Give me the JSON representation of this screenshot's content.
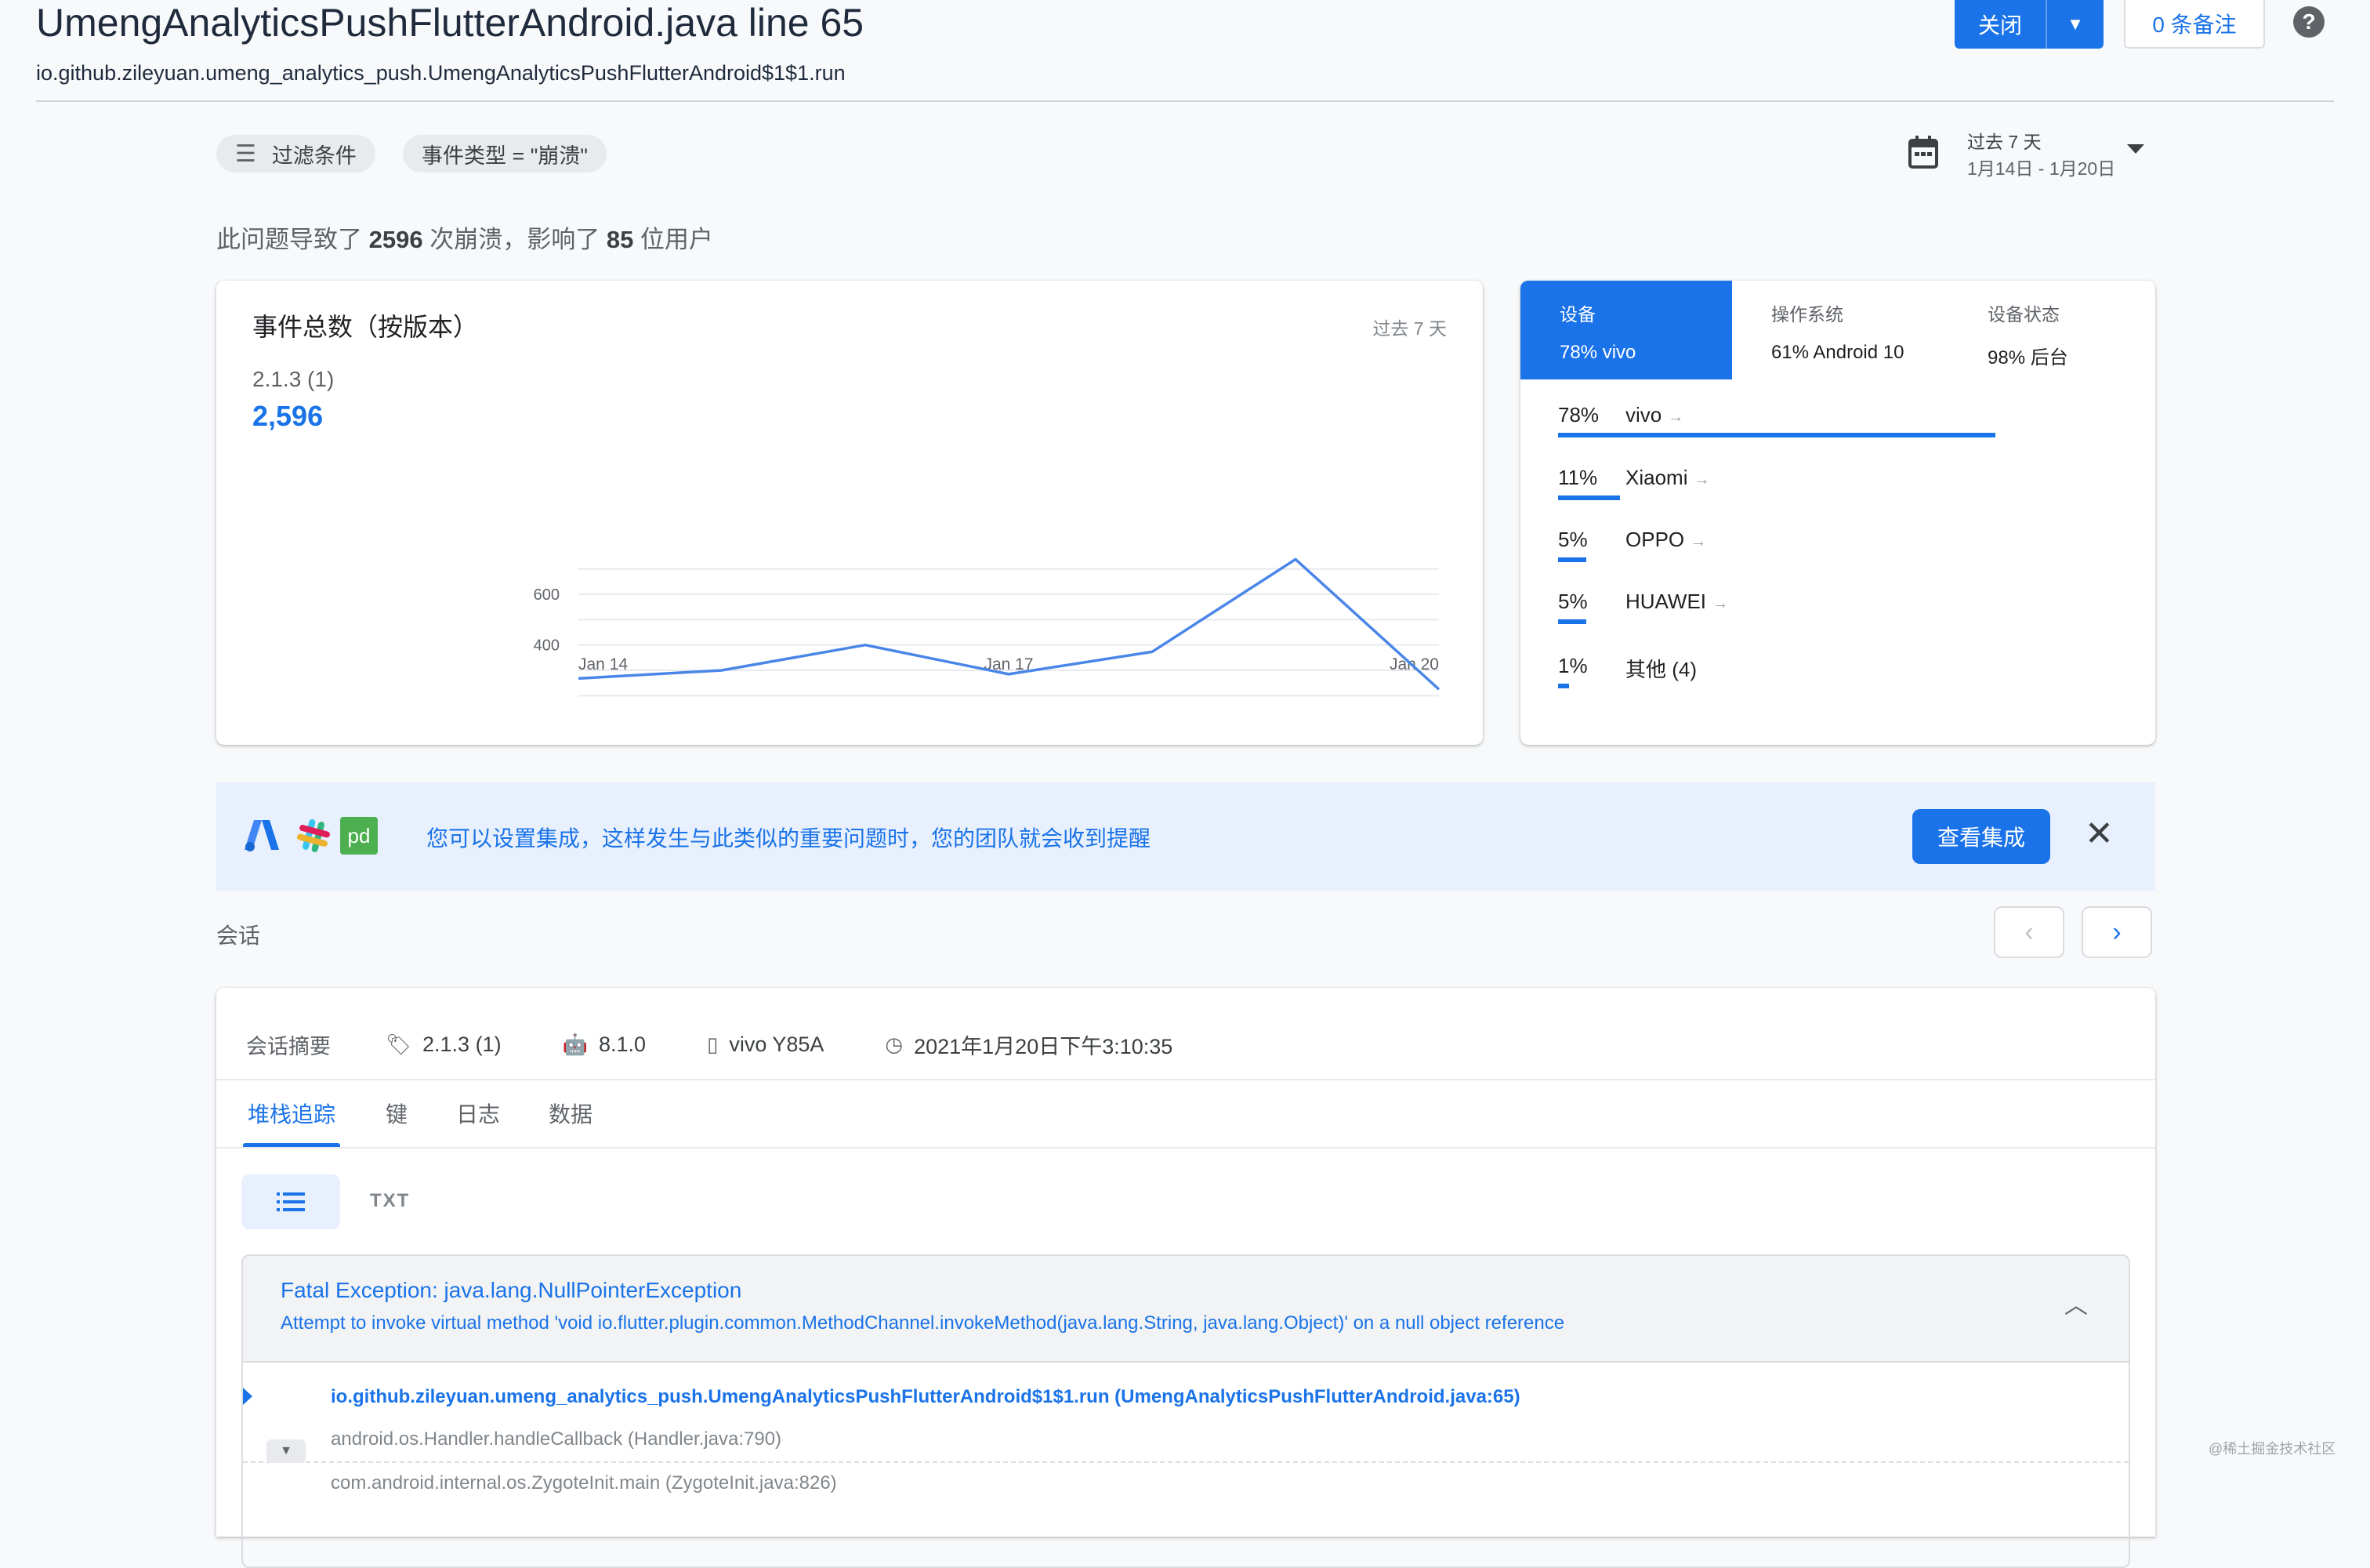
{
  "header": {
    "title": "UmengAnalyticsPushFlutterAndroid.java line 65",
    "subtitle": "io.github.zileyuan.umeng_analytics_push.UmengAnalyticsPushFlutterAndroid$1$1.run",
    "close_label": "关闭",
    "notes_label": "0 条备注",
    "help_label": "?"
  },
  "filters": {
    "filter_label": "过滤条件",
    "event_type": "事件类型 = \"崩溃\"",
    "date_range": "过去 7 天",
    "date_sub": "1月14日 - 1月20日"
  },
  "summary": {
    "prefix": "此问题导致了 ",
    "crashes": "2596",
    "middle": " 次崩溃，影响了 ",
    "users": "85",
    "suffix": " 位用户"
  },
  "events_chart": {
    "title": "事件总数（按版本）",
    "range_label": "过去 7 天",
    "version": "2.1.3 (1)",
    "total": "2,596"
  },
  "chart_data": {
    "type": "line",
    "title": "事件总数（按版本）",
    "x": [
      "Jan 14",
      "Jan 15",
      "Jan 16",
      "Jan 17",
      "Jan 18",
      "Jan 19",
      "Jan 20"
    ],
    "series": [
      {
        "name": "2.1.3 (1)",
        "values": [
          268,
          300,
          400,
          285,
          373,
          738,
          225
        ]
      }
    ],
    "x_tick_labels": [
      "Jan 14",
      "Jan 17",
      "Jan 20"
    ],
    "y_ticks": [
      400,
      600
    ],
    "ylim": [
      200,
      800
    ],
    "grid": true,
    "color": "#4a86e8"
  },
  "device_panel": {
    "tabs": [
      {
        "label": "设备",
        "value": "78% vivo",
        "active": true
      },
      {
        "label": "操作系统",
        "value": "61% Android 10",
        "active": false
      },
      {
        "label": "设备状态",
        "value": "98% 后台",
        "active": false
      }
    ],
    "rows": [
      {
        "pct": "78%",
        "name": "vivo",
        "share": 78,
        "link": true
      },
      {
        "pct": "11%",
        "name": "Xiaomi",
        "share": 11,
        "link": true
      },
      {
        "pct": "5%",
        "name": "OPPO",
        "share": 5,
        "link": true
      },
      {
        "pct": "5%",
        "name": "HUAWEI",
        "share": 5,
        "link": true
      },
      {
        "pct": "1%",
        "name": "其他 (4)",
        "share": 1,
        "link": false
      }
    ]
  },
  "banner": {
    "text": "您可以设置集成，这样发生与此类似的重要问题时，您的团队就会收到提醒",
    "button_label": "查看集成",
    "logo_pd": "pd"
  },
  "sessions": {
    "label": "会话",
    "meta": {
      "heading": "会话摘要",
      "version": "2.1.3 (1)",
      "os": "8.1.0",
      "device": "vivo Y85A",
      "time": "2021年1月20日下午3:10:35"
    },
    "tabs": [
      "堆栈追踪",
      "键",
      "日志",
      "数据"
    ],
    "txt_label": "TXT",
    "exception": {
      "title": "Fatal Exception: java.lang.NullPointerException",
      "message": "Attempt to invoke virtual method 'void io.flutter.plugin.common.MethodChannel.invokeMethod(java.lang.String, java.lang.Object)' on a null object reference",
      "frames": [
        "io.github.zileyuan.umeng_analytics_push.UmengAnalyticsPushFlutterAndroid$1$1.run (UmengAnalyticsPushFlutterAndroid.java:65)",
        "android.os.Handler.handleCallback (Handler.java:790)",
        "com.android.internal.os.ZygoteInit.main (ZygoteInit.java:826)"
      ]
    }
  },
  "watermark": "@稀土掘金技术社区"
}
